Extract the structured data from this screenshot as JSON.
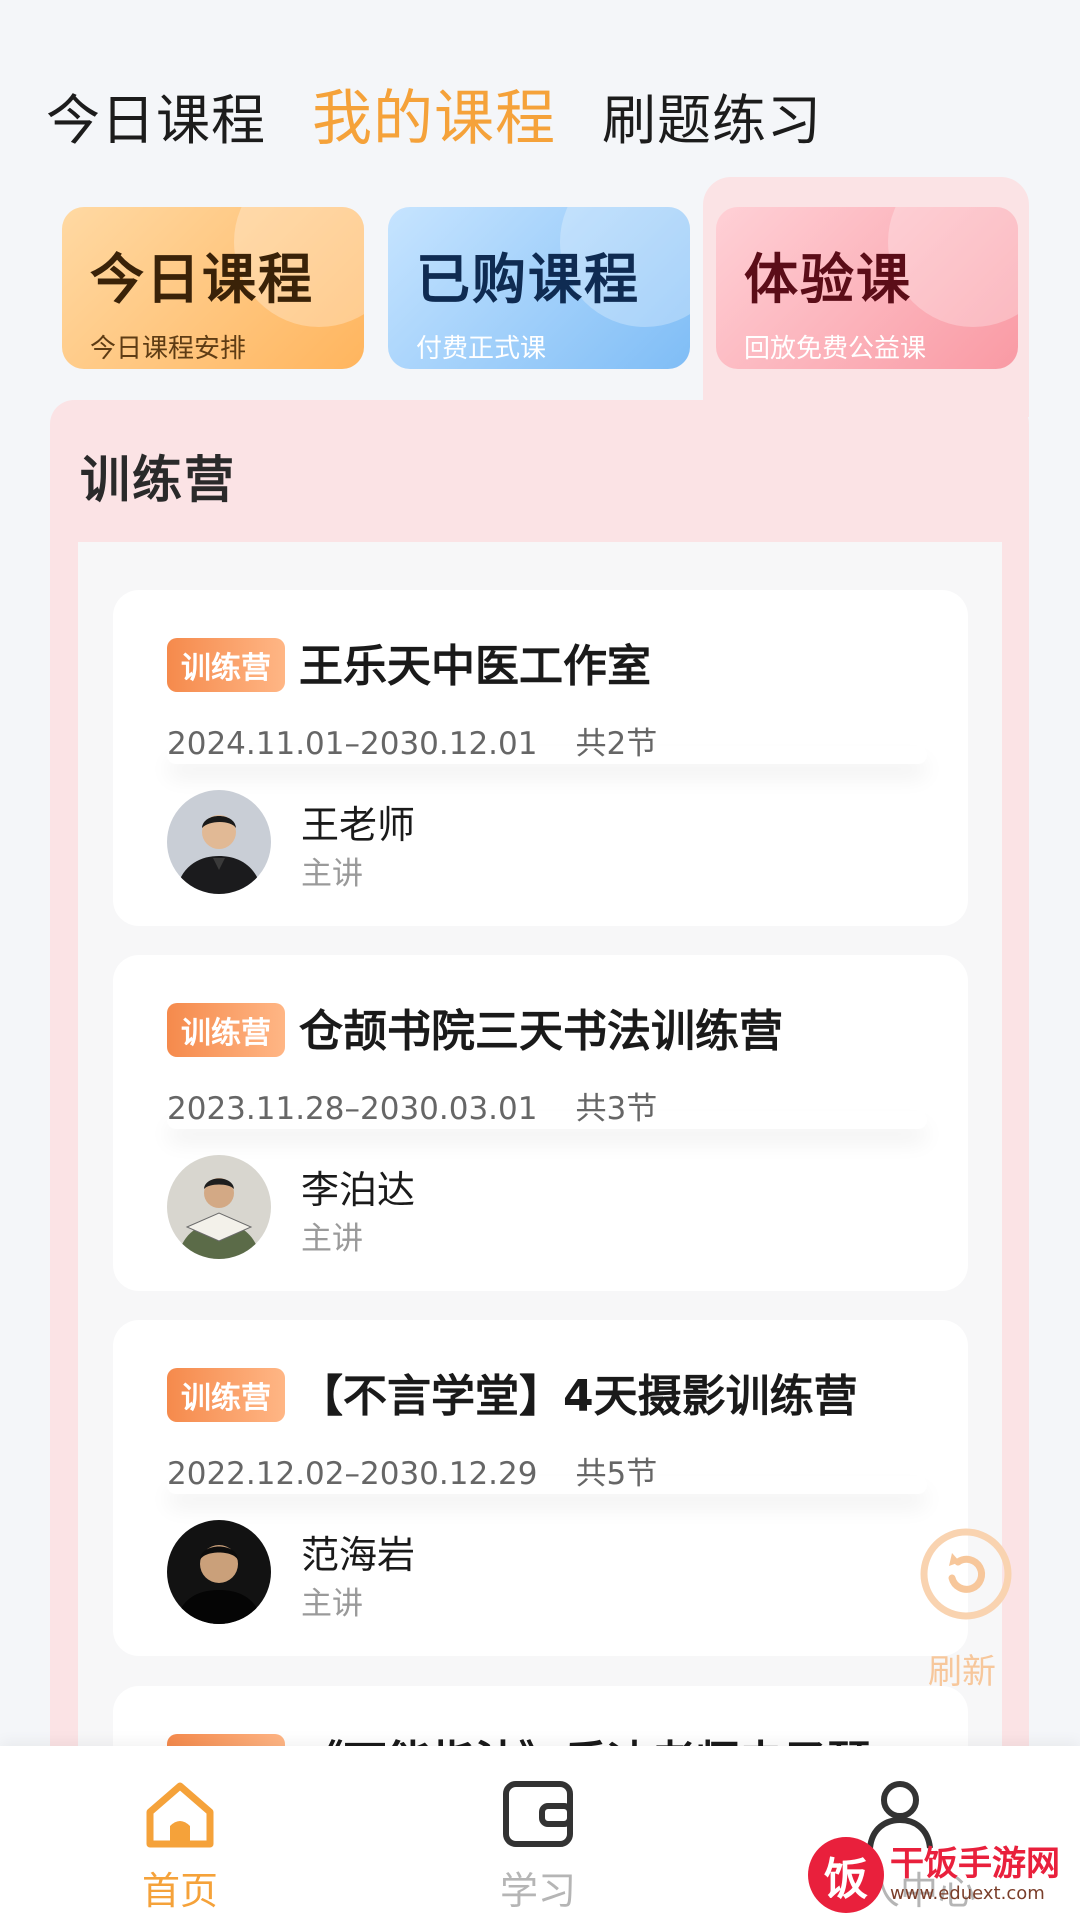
{
  "top_tabs": [
    {
      "label": "今日课程",
      "active": false
    },
    {
      "label": "我的课程",
      "active": true
    },
    {
      "label": "刷题练习",
      "active": false
    }
  ],
  "categories": [
    {
      "title": "今日课程",
      "subtitle": "今日课程安排"
    },
    {
      "title": "已购课程",
      "subtitle": "付费正式课"
    },
    {
      "title": "体验课",
      "subtitle": "回放免费公益课",
      "selected": true
    }
  ],
  "section": {
    "title": "训练营"
  },
  "courses": [
    {
      "badge": "训练营",
      "title": "王乐天中医工作室",
      "date_range": "2024.11.01–2030.12.01",
      "lessons": "共2节",
      "teacher": "王老师",
      "role": "主讲"
    },
    {
      "badge": "训练营",
      "title": "仓颉书院三天书法训练营",
      "date_range": "2023.11.28–2030.03.01",
      "lessons": "共3节",
      "teacher": "李泊达",
      "role": "主讲"
    },
    {
      "badge": "训练营",
      "title": "【不言学堂】4天摄影训练营",
      "date_range": "2022.12.02–2030.12.29",
      "lessons": "共5节",
      "teacher": "范海岩",
      "role": "主讲"
    },
    {
      "badge": "训练营",
      "title": "《万能指法》乐迪老师电子琴"
    }
  ],
  "refresh": {
    "label": "刷新"
  },
  "bottom_nav": [
    {
      "label": "首页",
      "icon": "home-icon",
      "active": true
    },
    {
      "label": "学习",
      "icon": "wallet-icon",
      "active": false
    },
    {
      "label": "个人中心",
      "icon": "user-icon",
      "active": false
    }
  ],
  "watermark": {
    "mark": "饭",
    "name": "干饭手游网",
    "url": "www.eduext.com"
  },
  "colors": {
    "accent": "#f5a23a",
    "panel": "#fbe3e5",
    "badge": "#f58a4c"
  }
}
